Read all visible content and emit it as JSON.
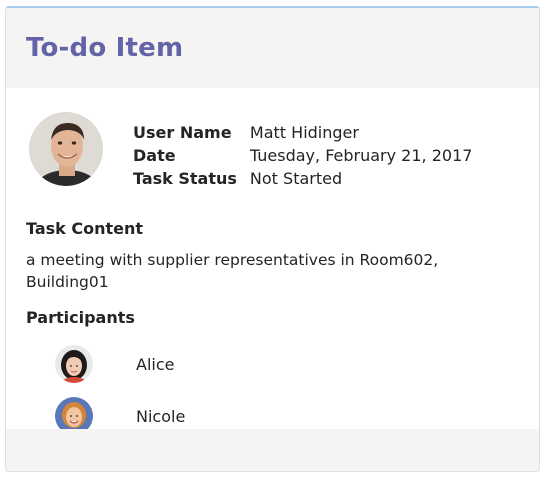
{
  "card": {
    "title": "To-do Item",
    "user": {
      "avatar_icon": "user-avatar-icon",
      "facts": [
        {
          "key": "User Name",
          "value": "Matt Hidinger"
        },
        {
          "key": "Date",
          "value": "Tuesday, February 21, 2017"
        },
        {
          "key": "Task Status",
          "value": "Not Started"
        }
      ]
    },
    "task_content_label": "Task Content",
    "task_content": "a meeting with supplier representatives in Room602, Building01",
    "participants_label": "Participants",
    "participants": [
      {
        "name": "Alice",
        "avatar_icon": "alice-avatar-icon"
      },
      {
        "name": "Nicole",
        "avatar_icon": "nicole-avatar-icon"
      }
    ]
  },
  "colors": {
    "title": "#6264a7",
    "header_bg": "#f5f4f3",
    "accent_border": "#a8cdf0"
  }
}
